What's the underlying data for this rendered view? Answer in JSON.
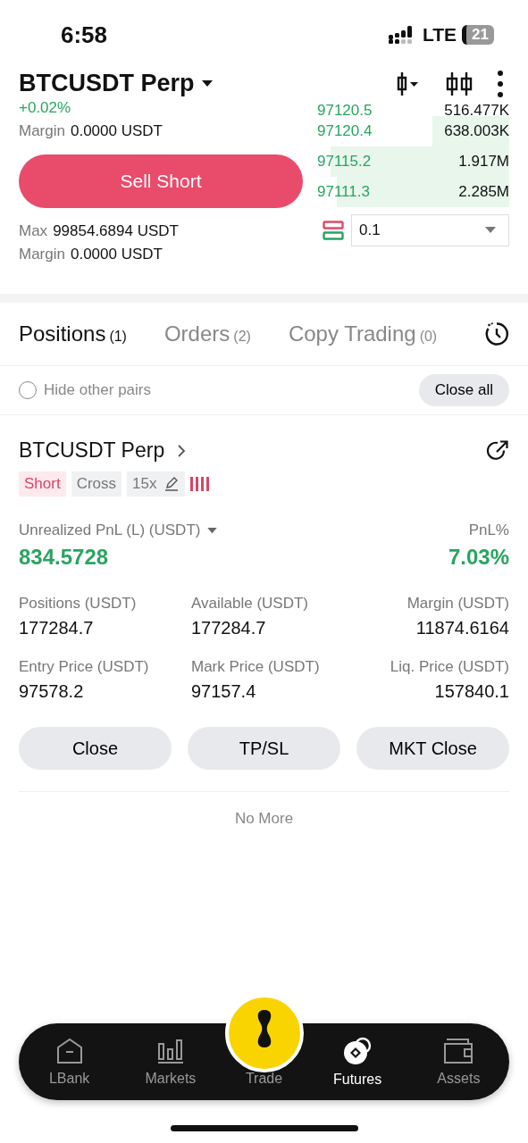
{
  "status_bar": {
    "time": "6:58",
    "network": "LTE",
    "battery": "21"
  },
  "header": {
    "title": "BTCUSDT Perp",
    "change": "+0.02%"
  },
  "order_form": {
    "margin_label": "Margin",
    "margin_value": "0.0000 USDT",
    "sell_button": "Sell Short",
    "max_label": "Max",
    "max_value": "99854.6894 USDT",
    "margin2_label": "Margin",
    "margin2_value": "0.0000 USDT"
  },
  "order_book": {
    "rows": [
      {
        "price": "97120.5",
        "amount": "516.477K"
      },
      {
        "price": "97120.4",
        "amount": "638.003K"
      },
      {
        "price": "97115.2",
        "amount": "1.917M"
      },
      {
        "price": "97111.3",
        "amount": "2.285M"
      }
    ],
    "precision": "0.1"
  },
  "tabs": [
    {
      "label": "Positions",
      "count": "(1)",
      "selected": true
    },
    {
      "label": "Orders",
      "count": "(2)",
      "selected": false
    },
    {
      "label": "Copy Trading",
      "count": "(0)",
      "selected": false
    }
  ],
  "filter": {
    "label": "Hide other pairs",
    "checked": false,
    "close_all": "Close all"
  },
  "position": {
    "symbol": "BTCUSDT Perp",
    "side": "Short",
    "mode": "Cross",
    "leverage": "15x",
    "pnl_label": "Unrealized PnL (L) (USDT)",
    "pnl_value": "834.5728",
    "pnl_pct_label": "PnL%",
    "pnl_pct_value": "7.03%",
    "stats": [
      {
        "label": "Positions (USDT)",
        "value": "177284.7"
      },
      {
        "label": "Available (USDT)",
        "value": "177284.7"
      },
      {
        "label": "Margin (USDT)",
        "value": "11874.6164"
      },
      {
        "label": "Entry Price (USDT)",
        "value": "97578.2"
      },
      {
        "label": "Mark Price (USDT)",
        "value": "97157.4"
      },
      {
        "label": "Liq. Price (USDT)",
        "value": "157840.1"
      }
    ],
    "buttons": [
      "Close",
      "TP/SL",
      "MKT Close"
    ]
  },
  "footer_note": "No More",
  "nav": [
    {
      "label": "LBank",
      "kind": "home",
      "selected": false
    },
    {
      "label": "Markets",
      "kind": "markets",
      "selected": false
    },
    {
      "label": "Trade",
      "kind": "trade",
      "selected": false
    },
    {
      "label": "Futures",
      "kind": "futures",
      "selected": true
    },
    {
      "label": "Assets",
      "kind": "assets",
      "selected": false
    }
  ]
}
